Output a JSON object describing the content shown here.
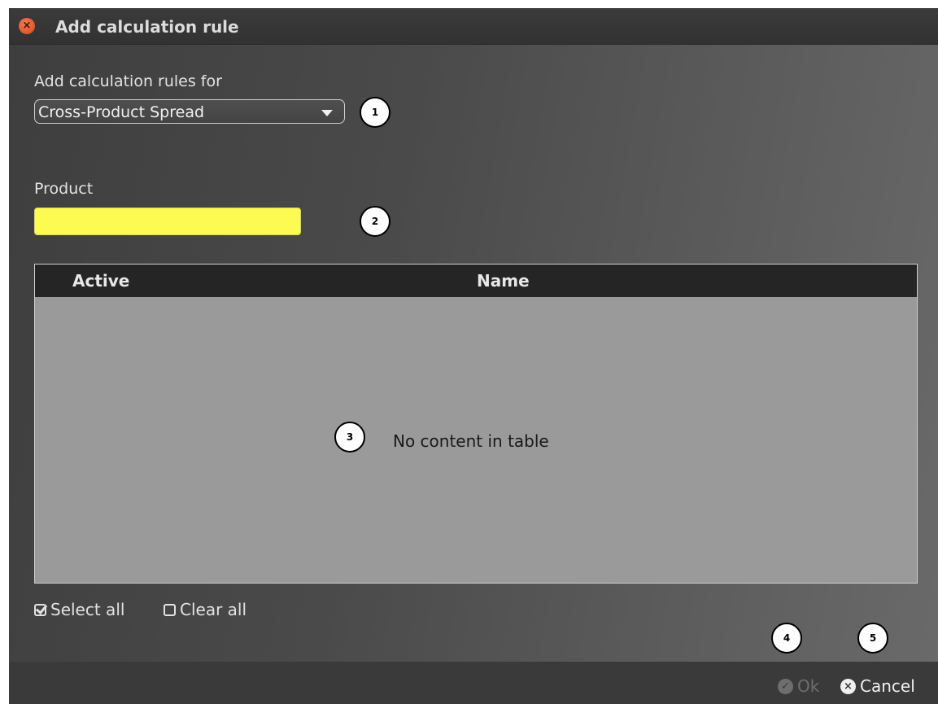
{
  "window": {
    "title": "Add calculation rule",
    "close_glyph": "×"
  },
  "form": {
    "rules_for_label": "Add calculation rules for",
    "rules_for_value": "Cross-Product Spread",
    "product_label": "Product",
    "product_value": "",
    "product_bg_color": "#fdfa52"
  },
  "table": {
    "columns": [
      "Active",
      "Name"
    ],
    "rows": [],
    "empty_text": "No content in table"
  },
  "selection": {
    "select_all_label": "Select all",
    "clear_all_label": "Clear all"
  },
  "footer": {
    "ok_label": "Ok",
    "ok_icon": "check-circle-icon",
    "cancel_label": "Cancel",
    "cancel_icon": "x-circle-icon"
  },
  "callouts": [
    "1",
    "2",
    "3",
    "4",
    "5"
  ]
}
